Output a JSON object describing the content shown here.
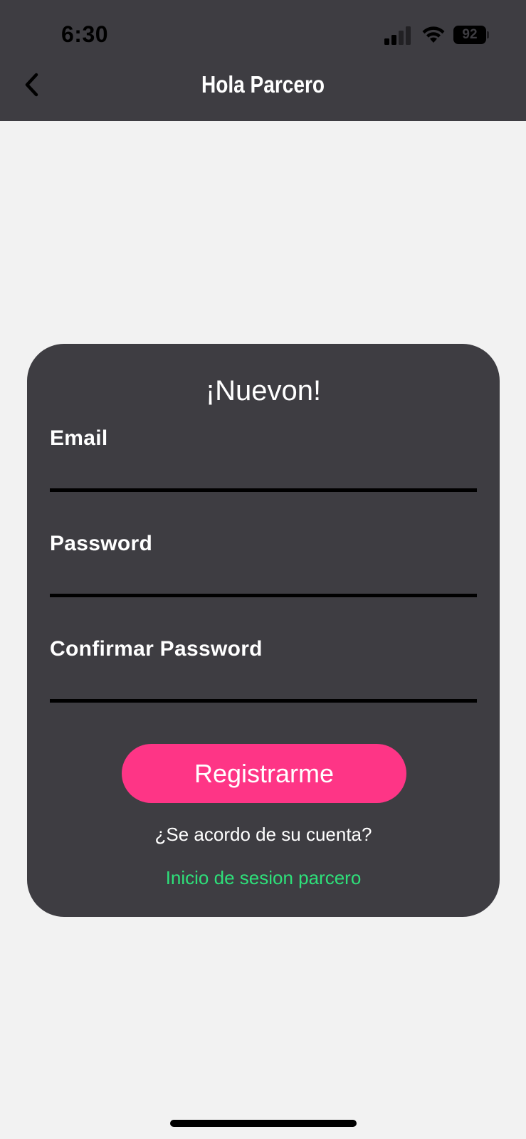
{
  "status_bar": {
    "time": "6:30",
    "battery_level": "92"
  },
  "nav": {
    "title": "Hola Parcero",
    "back_icon": "chevron-left-icon"
  },
  "card": {
    "title": "¡Nuevon!",
    "fields": [
      {
        "label": "Email",
        "value": ""
      },
      {
        "label": "Password",
        "value": ""
      },
      {
        "label": "Confirmar Password",
        "value": ""
      }
    ],
    "register_label": "Registrarme",
    "account_question": "¿Se acordo de su cuenta?",
    "login_link": "Inicio de sesion parcero"
  },
  "colors": {
    "bar_background": "#3e3d42",
    "page_background": "#f2f2f2",
    "accent_pink": "#fe3586",
    "link_green": "#2ee07a"
  }
}
